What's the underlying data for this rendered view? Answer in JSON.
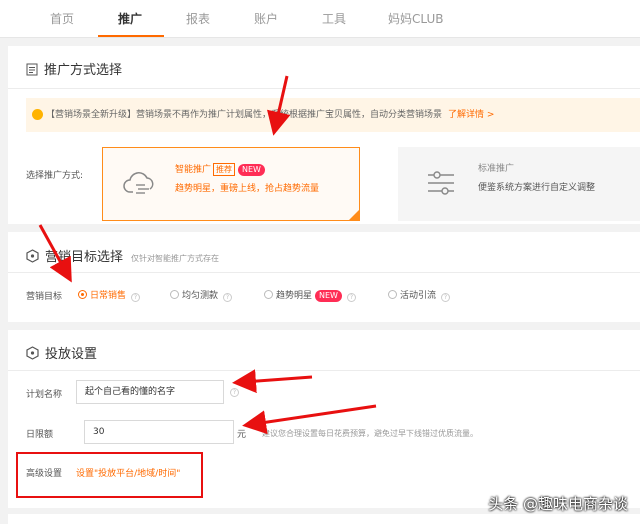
{
  "nav": {
    "items": [
      "首页",
      "推广",
      "报表",
      "账户",
      "工具",
      "妈妈CLUB"
    ],
    "active": 1
  },
  "section1": {
    "title": "推广方式选择",
    "notice_text": "【营销场景全新升级】营销场景不再作为推广计划属性，系统根据推广宝贝属性，自动分类营销场景",
    "notice_link": "了解详情 >",
    "row_label": "选择推广方式:",
    "smart": {
      "name": "智能推广",
      "tag_recommend": "推荐",
      "tag_new": "NEW",
      "desc": "趋势明星，重磅上线，抢占趋势流量"
    },
    "standard": {
      "name": "标准推广",
      "desc": "便鉴系统方案进行自定义调整"
    }
  },
  "section2": {
    "title": "营销目标选择",
    "subtitle": "仅针对智能推广方式存在",
    "row_label": "营销目标",
    "options": [
      {
        "label": "日常销售",
        "checked": true
      },
      {
        "label": "均匀测款",
        "checked": false
      },
      {
        "label": "趋势明星",
        "checked": false,
        "tag": "NEW"
      },
      {
        "label": "活动引流",
        "checked": false
      }
    ]
  },
  "section3": {
    "title": "投放设置",
    "plan_label": "计划名称",
    "plan_value": "起个自己看的懂的名字",
    "budget_label": "日限额",
    "budget_value": "30",
    "budget_unit": "元",
    "budget_hint": "建议您合理设置每日花费预算，避免过早下线错过优质流量。",
    "advanced_label": "高级设置",
    "advanced_link": "设置\"投放平台/地域/时间\""
  },
  "watermark": "头条 @趣味电商杂谈",
  "colors": {
    "accent": "#ff6a00",
    "annotation_red": "#e81010",
    "notice_bg": "#fff5e6",
    "new_tag": "#ff2d55"
  }
}
